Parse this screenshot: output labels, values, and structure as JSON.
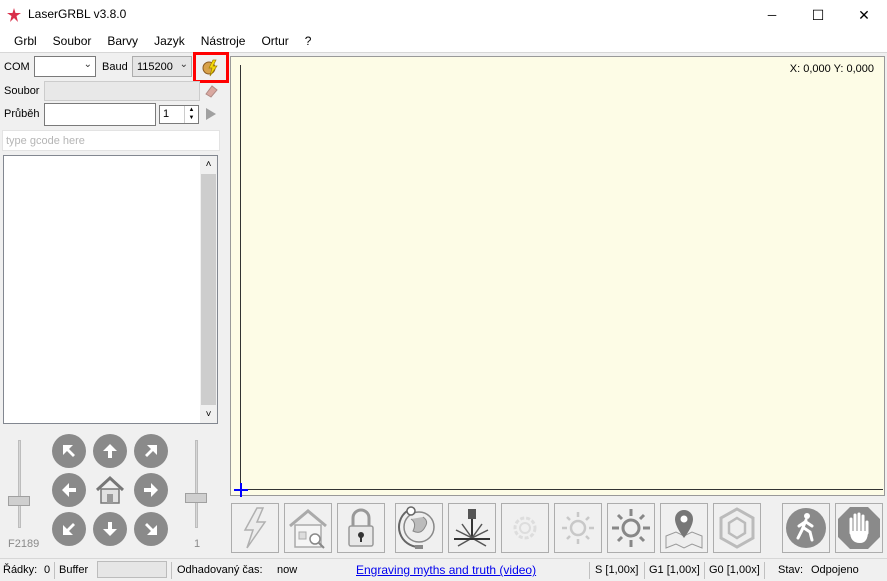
{
  "window": {
    "title": "LaserGRBL v3.8.0",
    "minimize": "─",
    "maximize": "☐",
    "close": "✕"
  },
  "menu": [
    "Grbl",
    "Soubor",
    "Barvy",
    "Jazyk",
    "Nástroje",
    "Ortur",
    "?"
  ],
  "connection": {
    "com_label": "COM",
    "com_value": "",
    "baud_label": "Baud",
    "baud_value": "115200",
    "connect_icon": "connect-lightning-icon"
  },
  "file": {
    "label": "Soubor",
    "value": ""
  },
  "progress": {
    "label": "Průběh",
    "value": "",
    "passes": "1"
  },
  "gcode": {
    "placeholder": "type gcode here"
  },
  "jog": {
    "feed_label": "F2189",
    "step_label": "1"
  },
  "preview": {
    "coords": "X: 0,000 Y: 0,000",
    "background": "#fdfce6",
    "origin_color": "#0000ff"
  },
  "tools": [
    "engrave-lightning-icon",
    "home-icon",
    "unlock-icon",
    "globe-icon",
    "laser-icon",
    "focus-dim-icon",
    "sun-small-icon",
    "sun-large-icon",
    "map-pin-icon",
    "hexagon-icon",
    "walking-man-icon",
    "stop-hand-icon"
  ],
  "status": {
    "lines_label": "Řádky:",
    "lines_value": "0",
    "buffer_label": "Buffer",
    "time_label": "Odhadovaný čas:",
    "time_value": "now",
    "link": "Engraving myths and truth (video)",
    "s_override": "S [1,00x]",
    "g1_override": "G1 [1,00x]",
    "g0_override": "G0 [1,00x]",
    "state_label": "Stav:",
    "state_value": "Odpojeno"
  },
  "highlight_color": "#ff0000"
}
